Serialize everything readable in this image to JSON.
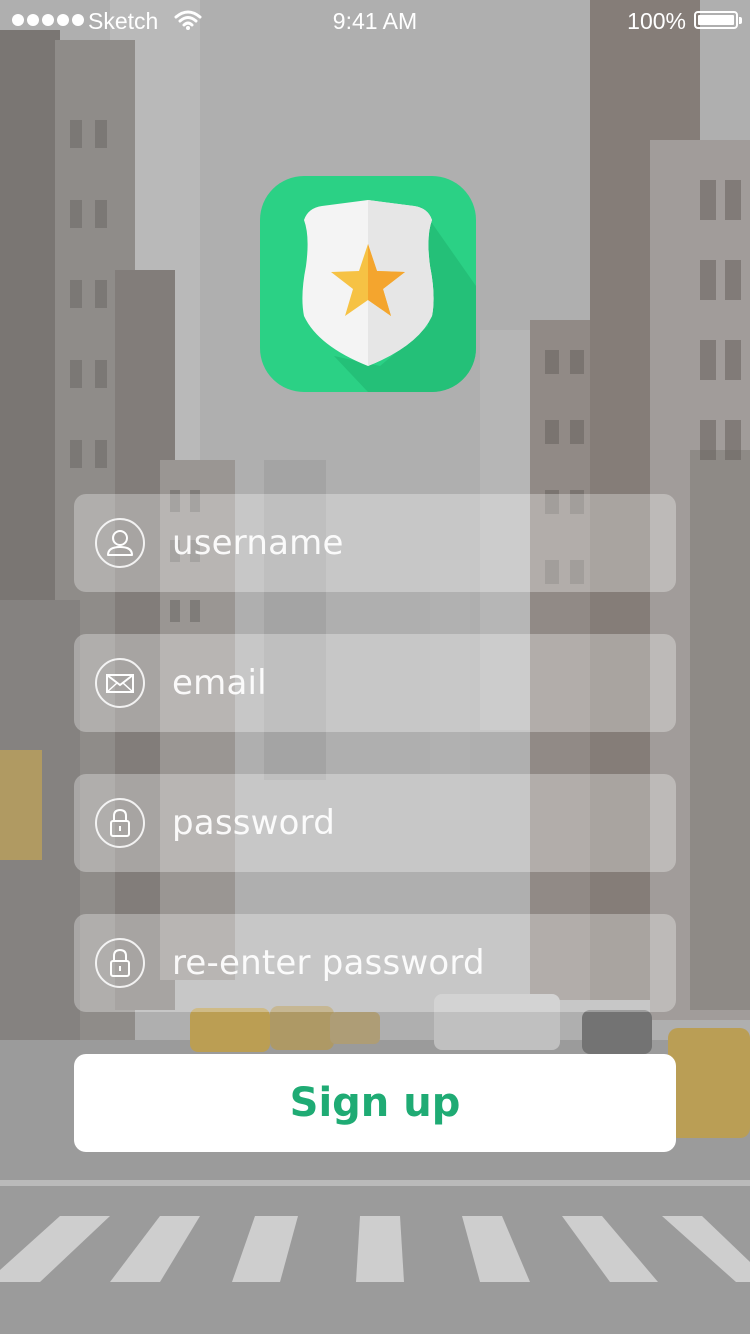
{
  "status_bar": {
    "carrier": "Sketch",
    "time": "9:41 AM",
    "battery_percent": "100%",
    "signal_icon": "signal-dots-icon",
    "wifi_icon": "wifi-icon",
    "battery_icon": "battery-icon"
  },
  "logo": {
    "icon": "police-badge-star-icon",
    "colors": {
      "tile": "#2bd185",
      "shield": "#f4f4f4",
      "star": "#f6b93b"
    }
  },
  "form": {
    "username": {
      "placeholder": "username",
      "icon": "user-icon"
    },
    "email": {
      "placeholder": "email",
      "icon": "envelope-icon"
    },
    "password": {
      "placeholder": "password",
      "icon": "lock-icon"
    },
    "repassword": {
      "placeholder": "re-enter password",
      "icon": "lock-icon"
    }
  },
  "signup_button": {
    "label": "Sign up",
    "color": "#1fab74"
  }
}
